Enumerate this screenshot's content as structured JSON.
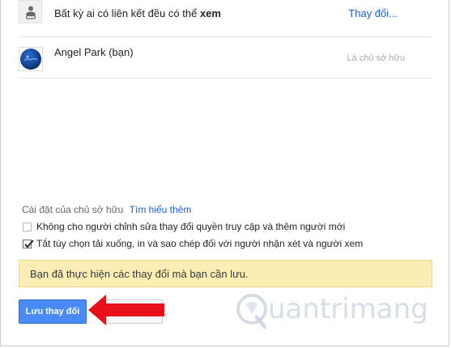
{
  "share": {
    "link_row": {
      "text_prefix": "Bất kỳ ai có liên kết đều có thể",
      "text_emphasis": "xem",
      "change_link": "Thay đổi..."
    },
    "owner_row": {
      "name": "Angel Park (bạn)",
      "role": "Là chủ sở hữu"
    }
  },
  "owner_settings": {
    "label": "Cài đặt của chủ sở hữu",
    "learn_more": "Tìm hiểu thêm"
  },
  "options": [
    {
      "label": "Không cho người chỉnh sửa thay đổi quyền truy cập và thêm người mới",
      "checked": false
    },
    {
      "label": "Tắt tùy chọn tải xuống, in và sao chép đối với người nhận xét và người xem",
      "checked": true
    }
  ],
  "notice": "Bạn đã thực hiện các thay đổi mà bạn cần lưu.",
  "buttons": {
    "save": "Lưu thay đổi"
  },
  "watermark": "uantrimang",
  "colors": {
    "link": "#1a5fd1",
    "primary_button": "#4a8af4",
    "notice_bg": "#fbeeb4",
    "arrow": "#e8101b"
  }
}
